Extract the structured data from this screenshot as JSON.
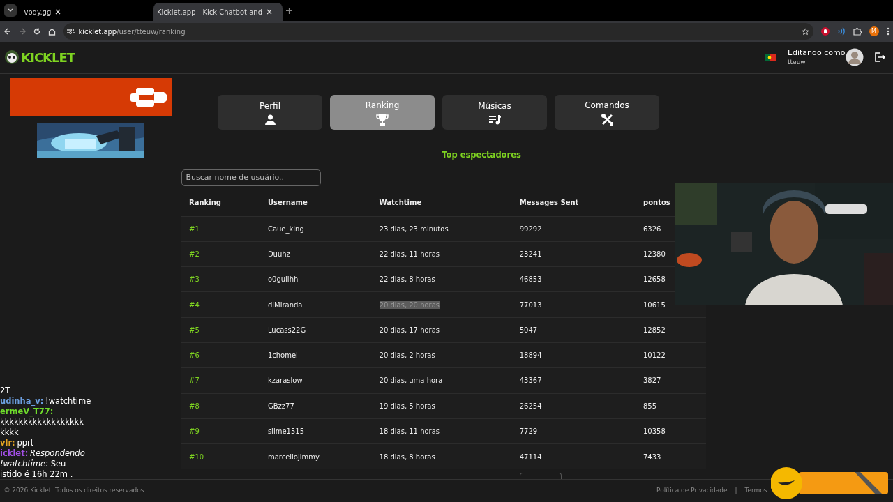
{
  "browser": {
    "tabs": [
      {
        "title": "vody.gg",
        "selected": false
      },
      {
        "title": "Kicklet.app - Kick Chatbot and",
        "selected": true
      }
    ],
    "address": {
      "host": "kicklet.app",
      "path": "/user/tteuw/ranking"
    },
    "profile": "M"
  },
  "header": {
    "logo": "KICKLET",
    "editing_label": "Editando como",
    "username": "tteuw"
  },
  "nav_tabs": [
    {
      "label": "Perfil",
      "selected": false
    },
    {
      "label": "Ranking",
      "selected": true
    },
    {
      "label": "Músicas",
      "selected": false
    },
    {
      "label": "Comandos",
      "selected": false
    }
  ],
  "section_title": "Top espectadores",
  "search": {
    "placeholder": "Buscar nome de usuário.."
  },
  "table": {
    "columns": [
      "Ranking",
      "Username",
      "Watchtime",
      "Messages Sent",
      "pontos"
    ],
    "rows": [
      {
        "rank": "#1",
        "username": "Caue_king",
        "watchtime": "23 dias, 23 minutos",
        "messages": "99292",
        "points": "6326",
        "watchtime_highlighted": false
      },
      {
        "rank": "#2",
        "username": "Duuhz",
        "watchtime": "22 dias, 11 horas",
        "messages": "23241",
        "points": "12380",
        "watchtime_highlighted": false
      },
      {
        "rank": "#3",
        "username": "o0guiihh",
        "watchtime": "22 dias, 8 horas",
        "messages": "46853",
        "points": "12658",
        "watchtime_highlighted": false
      },
      {
        "rank": "#4",
        "username": "diMiranda",
        "watchtime": "20 dias, 20 horas",
        "messages": "77013",
        "points": "10615",
        "watchtime_highlighted": true
      },
      {
        "rank": "#5",
        "username": "Lucass22G",
        "watchtime": "20 dias, 17 horas",
        "messages": "5047",
        "points": "12852",
        "watchtime_highlighted": false
      },
      {
        "rank": "#6",
        "username": "1chomei",
        "watchtime": "20 dias, 2 horas",
        "messages": "18894",
        "points": "10122",
        "watchtime_highlighted": false
      },
      {
        "rank": "#7",
        "username": "kzaraslow",
        "watchtime": "20 dias, uma hora",
        "messages": "43367",
        "points": "3827",
        "watchtime_highlighted": false
      },
      {
        "rank": "#8",
        "username": "GBzz77",
        "watchtime": "19 dias, 5 horas",
        "messages": "26254",
        "points": "855",
        "watchtime_highlighted": false
      },
      {
        "rank": "#9",
        "username": "slime1515",
        "watchtime": "18 dias, 11 horas",
        "messages": "7729",
        "points": "10358",
        "watchtime_highlighted": false
      },
      {
        "rank": "#10",
        "username": "marcellojimmy",
        "watchtime": "18 dias, 8 horas",
        "messages": "47114",
        "points": "7433",
        "watchtime_highlighted": false
      }
    ]
  },
  "chat_overlay": [
    {
      "text": "2T"
    },
    {
      "user": "udinha_v:",
      "color": "#6c9fe0",
      "text": "!watchtime"
    },
    {
      "user": "ermeV_T77:",
      "color": "#6fdc2b"
    },
    {
      "text": "kkkkkkkkkkkkkkkkkk"
    },
    {
      "text": "kkkk"
    },
    {
      "user": "vlr:",
      "color": "#e5a323",
      "text": "pprt"
    },
    {
      "user": "icklet:",
      "color": "#a24fe6",
      "text": "*Respondendo*"
    },
    {
      "text": "*!watchtime:* Seu"
    },
    {
      "text": "istido é 16h 22m ."
    }
  ],
  "footer": {
    "copyright": "© 2026 Kicklet. Todos os direitos reservados.",
    "links": [
      "Política de Privacidade",
      "|",
      "Termos"
    ]
  }
}
